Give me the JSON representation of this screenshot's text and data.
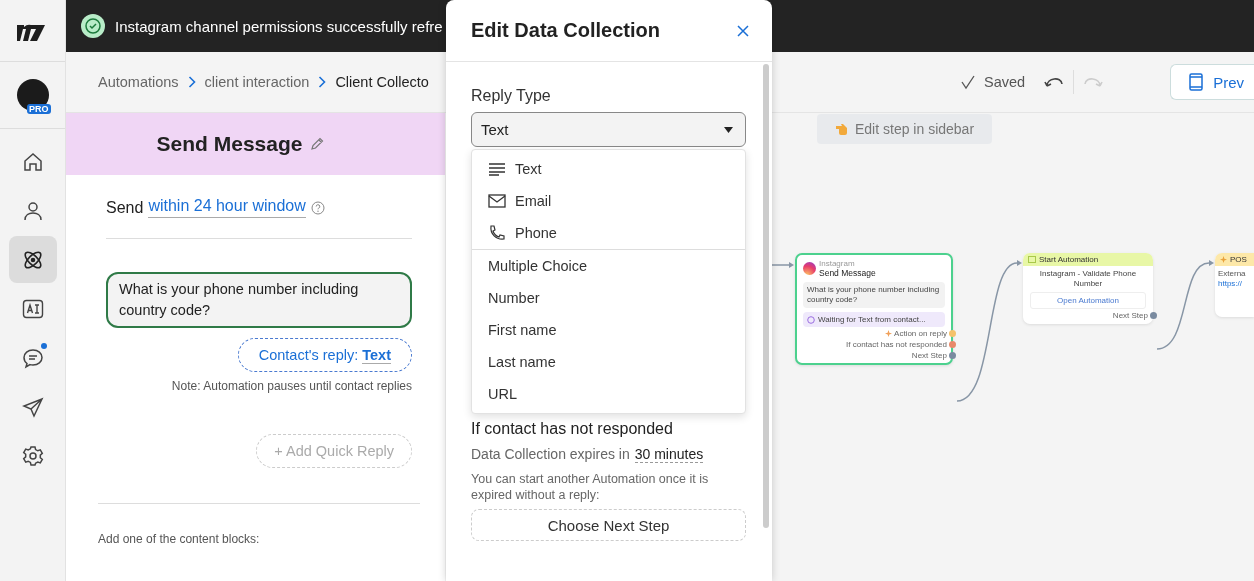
{
  "sidebar": {
    "badge": "PRO",
    "items": [
      {
        "selected": false,
        "dot": false
      },
      {
        "selected": false,
        "dot": false
      },
      {
        "selected": true,
        "dot": false
      },
      {
        "selected": false,
        "dot": false
      },
      {
        "selected": false,
        "dot": true
      },
      {
        "selected": false,
        "dot": false
      },
      {
        "selected": false,
        "dot": false
      }
    ]
  },
  "toast": {
    "message": "Instagram channel permissions successfully refre"
  },
  "breadcrumbs": [
    "Automations",
    "client interaction",
    "Client Collecto"
  ],
  "toolbar": {
    "status": "Saved",
    "undo": {
      "disabled": false
    },
    "redo": {
      "disabled": true
    },
    "preview": "Prev"
  },
  "step": {
    "title": "Send Message",
    "send_prefix": "Send",
    "send_window": "within 24 hour window",
    "message": "What is your phone number including country code?",
    "reply_label": "Contact's reply:",
    "reply_type": "Text",
    "note": "Note: Automation pauses until contact replies",
    "add_quick_reply": "+ Add Quick Reply",
    "content_blocks_hint": "Add one of the content blocks:"
  },
  "modal": {
    "title": "Edit Data Collection",
    "reply_type_label": "Reply Type",
    "reply_type_value": "Text",
    "options": [
      {
        "label": "Text",
        "kind": "text"
      },
      {
        "label": "Email",
        "kind": "email"
      },
      {
        "label": "Phone",
        "kind": "phone"
      },
      {
        "label": "Multiple Choice",
        "kind": "plain"
      },
      {
        "label": "Number",
        "kind": "plain"
      },
      {
        "label": "First name",
        "kind": "plain"
      },
      {
        "label": "Last name",
        "kind": "plain"
      },
      {
        "label": "URL",
        "kind": "plain"
      }
    ],
    "no_response_label": "If contact has not responded",
    "expires_label": "Data Collection expires in",
    "expires_value": "30 minutes",
    "expire_hint": "You can start another Automation once it is expired without a reply:",
    "next_step": "Choose Next Step"
  },
  "canvas": {
    "hint": "Edit step in sidebar",
    "nodes": [
      {
        "kind": "message",
        "selected": true,
        "channel": "Instagram",
        "title": "Send Message",
        "text": "What is your phone number including country code?",
        "status": "Waiting for Text from contact...",
        "outputs": [
          {
            "label": "Action on reply",
            "color": "#f5c26b"
          },
          {
            "label": "If contact has not responded",
            "color": "#e8896a"
          },
          {
            "label": "Next Step",
            "color": "#7a8ba0"
          }
        ]
      },
      {
        "kind": "automation",
        "selected": false,
        "title": "Start Automation",
        "text": "Instagram - Validate Phone Number",
        "button": "Open Automation",
        "outputs": [
          {
            "label": "Next Step",
            "color": "#7a8ba0"
          }
        ]
      },
      {
        "kind": "request",
        "selected": false,
        "title": "POS",
        "lines": [
          "Externa",
          "https://"
        ]
      }
    ]
  }
}
